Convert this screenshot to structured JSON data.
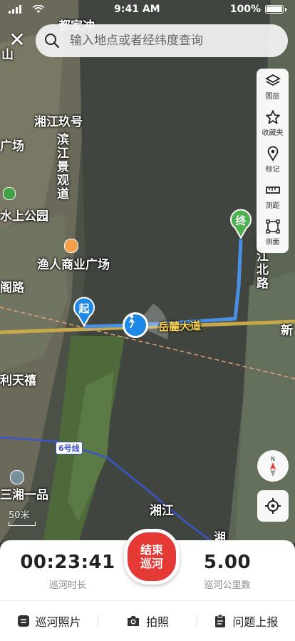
{
  "status_bar": {
    "time": "9:41 AM",
    "battery": "100%"
  },
  "search": {
    "placeholder": "输入地点或者经纬度查询"
  },
  "tools": [
    {
      "label": "图层",
      "icon": "layers-icon"
    },
    {
      "label": "收藏夹",
      "icon": "star-icon"
    },
    {
      "label": "标记",
      "icon": "location-pin-icon"
    },
    {
      "label": "测距",
      "icon": "ruler-icon"
    },
    {
      "label": "测面",
      "icon": "area-measure-icon"
    }
  ],
  "map": {
    "labels": {
      "l1": "都家冲",
      "l2": "山",
      "l3": "湘江玖号",
      "l4": "广场",
      "l5": "滨江景观道",
      "l6": "水上公园",
      "l7": "渔人商业广场",
      "l8": "阁路",
      "l9": "利天禧",
      "l10": "三湘一品",
      "l11": "湘江",
      "l12": "湘",
      "l13": "宾江北路",
      "l14": "新",
      "road": "岳麓大道",
      "line": "6号线"
    },
    "start_marker": "起",
    "end_marker": "终",
    "scale": "50米"
  },
  "stats": {
    "duration": {
      "value": "00:23:41",
      "label": "巡河时长"
    },
    "distance": {
      "value": "5.00",
      "label": "巡河公里数"
    },
    "end_button": {
      "line1": "结束",
      "line2": "巡河"
    }
  },
  "actions": [
    {
      "label": "巡河照片",
      "icon": "photo-list-icon"
    },
    {
      "label": "拍照",
      "icon": "camera-icon"
    },
    {
      "label": "问题上报",
      "icon": "report-icon"
    }
  ],
  "colors": {
    "accent": "#e53935",
    "route": "#4a90e2",
    "end_marker": "#4caf50",
    "start_marker": "#1e88e5"
  }
}
